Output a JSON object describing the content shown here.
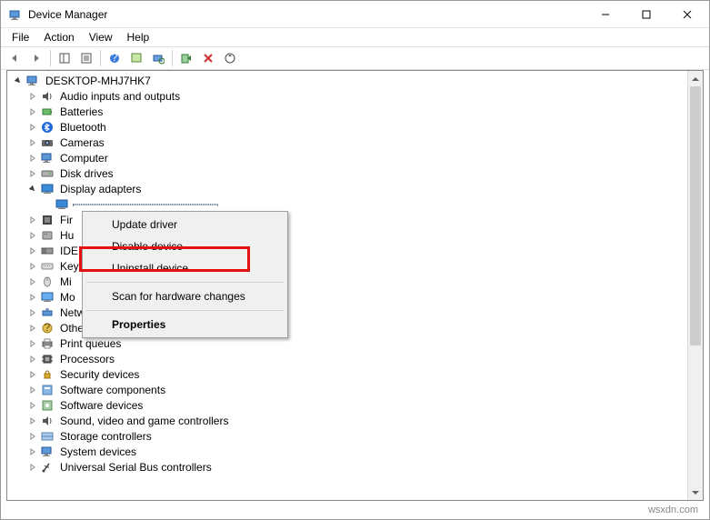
{
  "title": "Device Manager",
  "menubar": [
    "File",
    "Action",
    "View",
    "Help"
  ],
  "root": "DESKTOP-MHJ7HK7",
  "categories": [
    {
      "label": "Audio inputs and outputs",
      "icon": "speaker"
    },
    {
      "label": "Batteries",
      "icon": "battery"
    },
    {
      "label": "Bluetooth",
      "icon": "bluetooth"
    },
    {
      "label": "Cameras",
      "icon": "camera"
    },
    {
      "label": "Computer",
      "icon": "computer"
    },
    {
      "label": "Disk drives",
      "icon": "disk"
    },
    {
      "label": "Display adapters",
      "icon": "display",
      "expanded": true,
      "children": [
        {
          "label": "",
          "icon": "display",
          "selected": true
        }
      ]
    },
    {
      "label": "Fir",
      "icon": "firmware"
    },
    {
      "label": "Hu",
      "icon": "hid"
    },
    {
      "label": "IDE",
      "icon": "ide"
    },
    {
      "label": "Key",
      "icon": "keyboard"
    },
    {
      "label": "Mi",
      "icon": "mouse"
    },
    {
      "label": "Mo",
      "icon": "monitor"
    },
    {
      "label": "Network adapters",
      "icon": "network"
    },
    {
      "label": "Other devices",
      "icon": "other"
    },
    {
      "label": "Print queues",
      "icon": "printer"
    },
    {
      "label": "Processors",
      "icon": "cpu"
    },
    {
      "label": "Security devices",
      "icon": "security"
    },
    {
      "label": "Software components",
      "icon": "swcomp"
    },
    {
      "label": "Software devices",
      "icon": "swdev"
    },
    {
      "label": "Sound, video and game controllers",
      "icon": "sound"
    },
    {
      "label": "Storage controllers",
      "icon": "storage"
    },
    {
      "label": "System devices",
      "icon": "system"
    },
    {
      "label": "Universal Serial Bus controllers",
      "icon": "usb"
    }
  ],
  "context_menu": {
    "items": [
      {
        "label": "Update driver"
      },
      {
        "label": "Disable device"
      },
      {
        "label": "Uninstall device"
      },
      {
        "sep": true
      },
      {
        "label": "Scan for hardware changes"
      },
      {
        "sep": true
      },
      {
        "label": "Properties",
        "bold": true
      }
    ]
  },
  "watermark": "wsxdn.com"
}
